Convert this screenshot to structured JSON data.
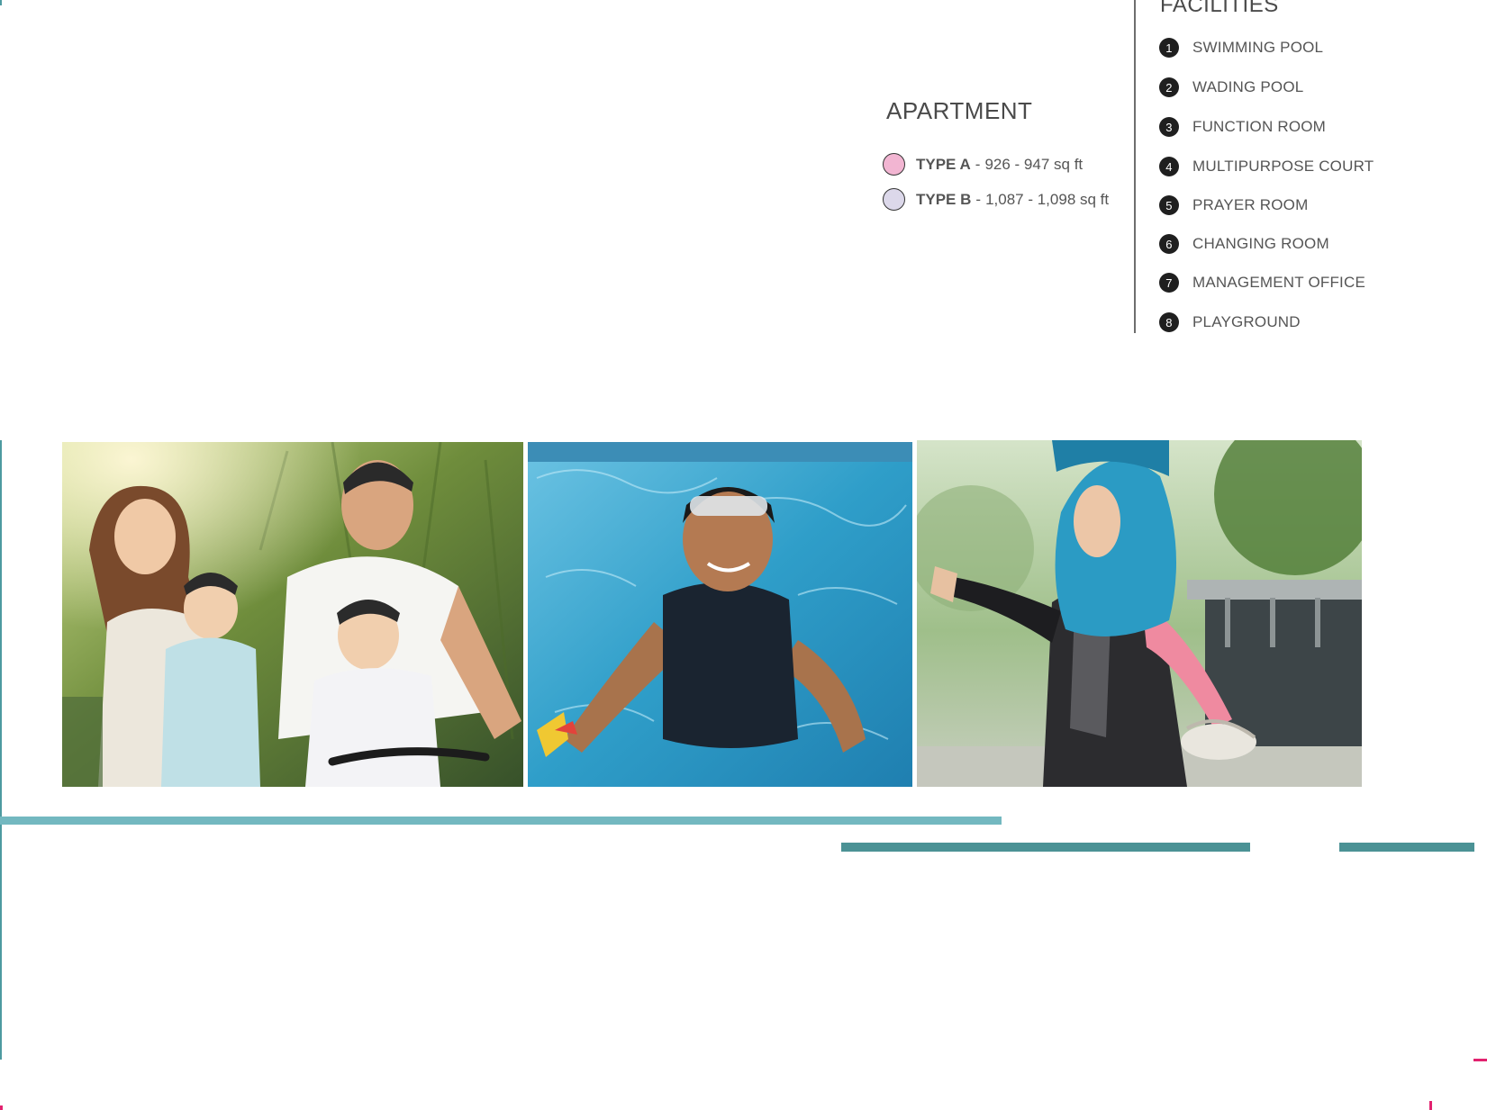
{
  "apartment": {
    "heading": "APARTMENT",
    "types": [
      {
        "label": "TYPE A",
        "sep": "-",
        "range": "926 - 947 sq ft",
        "color": "#f2b5d2"
      },
      {
        "label": "TYPE B",
        "sep": "-",
        "range": "1,087 - 1,098 sq ft",
        "color": "#dcd8ea"
      }
    ]
  },
  "facilities": {
    "heading": "FACILITIES",
    "items": [
      {
        "num": "1",
        "label": "SWIMMING POOL"
      },
      {
        "num": "2",
        "label": "WADING POOL"
      },
      {
        "num": "3",
        "label": "FUNCTION ROOM"
      },
      {
        "num": "4",
        "label": "MULTIPURPOSE COURT"
      },
      {
        "num": "5",
        "label": "PRAYER ROOM"
      },
      {
        "num": "6",
        "label": "CHANGING ROOM"
      },
      {
        "num": "7",
        "label": "MANAGEMENT OFFICE"
      },
      {
        "num": "8",
        "label": "PLAYGROUND"
      }
    ]
  },
  "colors": {
    "teal_light": "#73b8c0",
    "teal_dark": "#4b9295",
    "accent_pink": "#e2226f"
  }
}
